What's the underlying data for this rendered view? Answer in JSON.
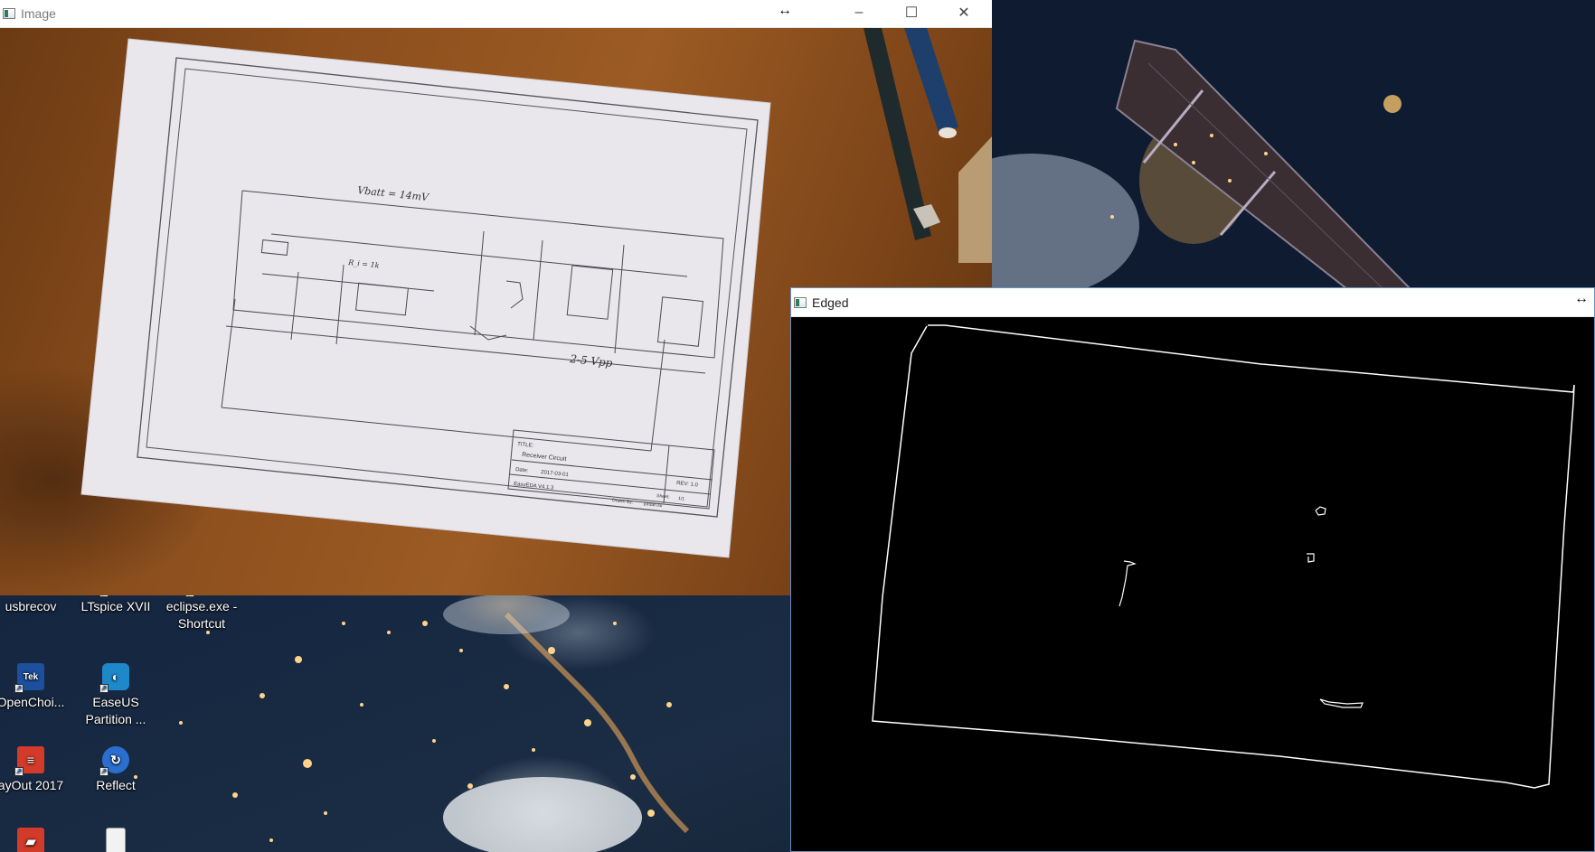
{
  "desktop": {
    "icons": [
      {
        "label": "usbrecov",
        "icon": "usb-recovery-icon",
        "color": "#d8a640"
      },
      {
        "label": "LTspice XVII",
        "icon": "ltspice-icon",
        "color": "#b03030"
      },
      {
        "label": "eclipse.exe - Shortcut",
        "icon": "eclipse-icon",
        "color": "#4b3b8f"
      },
      {
        "label": "OpenChoi...",
        "icon": "openchoice-tek-icon",
        "color": "#1c4f9c",
        "badge": "Tek"
      },
      {
        "label": "EaseUS Partition ...",
        "icon": "easeus-icon",
        "color": "#1e88c8"
      },
      {
        "label": "ayOut 2017",
        "icon": "layout-sketchup-icon",
        "color": "#d23a2a"
      },
      {
        "label": "Reflect",
        "icon": "reflect-icon",
        "color": "#2a6fd0"
      },
      {
        "label": "",
        "icon": "sketchup-icon",
        "color": "#d23a2a"
      },
      {
        "label": "",
        "icon": "document-icon",
        "color": "#f2f2f2"
      }
    ]
  },
  "image_window": {
    "title": "Image",
    "minimize": "–",
    "maximize": "☐",
    "close": "✕",
    "resize": "↔",
    "sheet_labels": {
      "title_block_title": "TITLE:",
      "title_block_name": "Receiver Circuit",
      "date_label": "Date:",
      "date_value": "2017-03-01",
      "rev": "REV: 1.0",
      "software": "EasyEDA V4.1.3",
      "sheet": "Sheet:",
      "sheet_value": "1/1",
      "drawn_by": "Drawn By:",
      "drawn_name": "jordan.lui",
      "vbatt": "Vbatt = 14mV",
      "vout": "2-5 Vpp",
      "ri": "R_i = 1k"
    }
  },
  "edged_window": {
    "title": "Edged",
    "resize": "↔"
  },
  "colors": {
    "titlebar_bg": "#ffffff",
    "edge_stroke": "#ffffff",
    "desk": "#8a4d1c"
  }
}
